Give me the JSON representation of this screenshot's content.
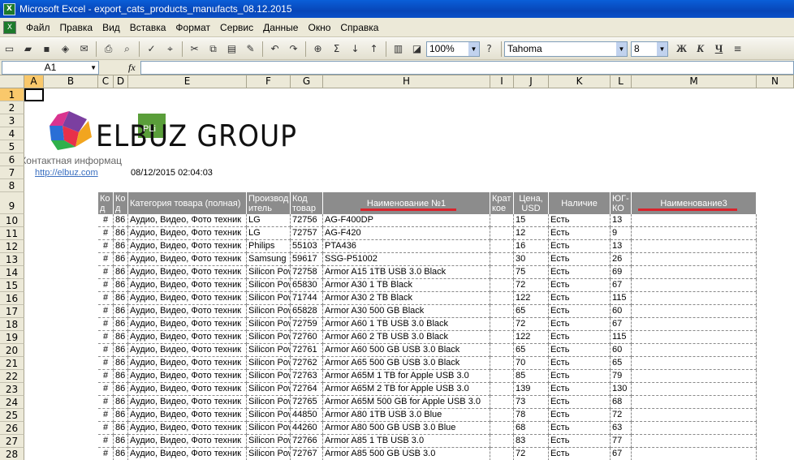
{
  "window": {
    "title": "Microsoft Excel - export_cats_products_manufacts_08.12.2015",
    "app_icon": "excel-icon"
  },
  "menu": [
    "Файл",
    "Правка",
    "Вид",
    "Вставка",
    "Формат",
    "Сервис",
    "Данные",
    "Окно",
    "Справка"
  ],
  "toolbar": {
    "zoom": "100%",
    "font": "Tahoma",
    "size": "8",
    "bold": "Ж",
    "italic": "К",
    "underline": "Ч"
  },
  "formula": {
    "cell": "A1",
    "fx": "fx"
  },
  "columns": [
    "A",
    "B",
    "C",
    "D",
    "E",
    "F",
    "G",
    "H",
    "I",
    "J",
    "K",
    "L",
    "M",
    "N"
  ],
  "rows": [
    "1",
    "2",
    "3",
    "4",
    "5",
    "6",
    "7",
    "8",
    "9",
    "10",
    "11",
    "12",
    "13",
    "14",
    "15",
    "16",
    "17",
    "18",
    "19",
    "20",
    "21",
    "22",
    "23",
    "24",
    "25",
    "26",
    "27",
    "28"
  ],
  "sheet": {
    "logo_text": "ELBUZ GROUP",
    "logo_badge": "PLi",
    "contact": "Контактная информац",
    "link": "http://elbuz.com",
    "datetime": "08/12/2015 02:04:03"
  },
  "headers": [
    "Ко д",
    "Ко д",
    "Категория товара (полная)",
    "Производ итель",
    "Код товар",
    "Наименование №1",
    "Крат кое",
    "Цена, USD",
    "Наличие",
    "ЮГ-КО",
    "Наименование3"
  ],
  "products": [
    {
      "c": "#",
      "d": "86",
      "cat": "Аудио, Видео, Фото техник",
      "mfr": "LG",
      "code": "72756",
      "name": "AG-F400DP",
      "price": "15",
      "stock": "Есть",
      "yug": "13"
    },
    {
      "c": "#",
      "d": "86",
      "cat": "Аудио, Видео, Фото техник",
      "mfr": "LG",
      "code": "72757",
      "name": "AG-F420",
      "price": "12",
      "stock": "Есть",
      "yug": "9"
    },
    {
      "c": "#",
      "d": "86",
      "cat": "Аудио, Видео, Фото техник",
      "mfr": "Philips",
      "code": "55103",
      "name": "PTA436",
      "price": "16",
      "stock": "Есть",
      "yug": "13"
    },
    {
      "c": "#",
      "d": "86",
      "cat": "Аудио, Видео, Фото техник",
      "mfr": "Samsung",
      "code": "59617",
      "name": "SSG-P51002",
      "price": "30",
      "stock": "Есть",
      "yug": "26"
    },
    {
      "c": "#",
      "d": "86",
      "cat": "Аудио, Видео, Фото техник",
      "mfr": "Silicon Pow",
      "code": "72758",
      "name": "Armor A15 1TB USB 3.0 Black",
      "price": "75",
      "stock": "Есть",
      "yug": "69"
    },
    {
      "c": "#",
      "d": "86",
      "cat": "Аудио, Видео, Фото техник",
      "mfr": "Silicon Pow",
      "code": "65830",
      "name": "Armor A30 1 TB Black",
      "price": "72",
      "stock": "Есть",
      "yug": "67"
    },
    {
      "c": "#",
      "d": "86",
      "cat": "Аудио, Видео, Фото техник",
      "mfr": "Silicon Pow",
      "code": "71744",
      "name": "Armor A30 2 TB Black",
      "price": "122",
      "stock": "Есть",
      "yug": "115"
    },
    {
      "c": "#",
      "d": "86",
      "cat": "Аудио, Видео, Фото техник",
      "mfr": "Silicon Pow",
      "code": "65828",
      "name": "Armor A30 500 GB Black",
      "price": "65",
      "stock": "Есть",
      "yug": "60"
    },
    {
      "c": "#",
      "d": "86",
      "cat": "Аудио, Видео, Фото техник",
      "mfr": "Silicon Pow",
      "code": "72759",
      "name": "Armor A60 1 TB USB 3.0 Black",
      "price": "72",
      "stock": "Есть",
      "yug": "67"
    },
    {
      "c": "#",
      "d": "86",
      "cat": "Аудио, Видео, Фото техник",
      "mfr": "Silicon Pow",
      "code": "72760",
      "name": "Armor A60 2 TB USB 3.0 Black",
      "price": "122",
      "stock": "Есть",
      "yug": "115"
    },
    {
      "c": "#",
      "d": "86",
      "cat": "Аудио, Видео, Фото техник",
      "mfr": "Silicon Pow",
      "code": "72761",
      "name": "Armor A60 500 GB USB 3.0 Black",
      "price": "65",
      "stock": "Есть",
      "yug": "60"
    },
    {
      "c": "#",
      "d": "86",
      "cat": "Аудио, Видео, Фото техник",
      "mfr": "Silicon Pow",
      "code": "72762",
      "name": "Armor A65 500 GB USB 3.0 Black",
      "price": "70",
      "stock": "Есть",
      "yug": "65"
    },
    {
      "c": "#",
      "d": "86",
      "cat": "Аудио, Видео, Фото техник",
      "mfr": "Silicon Pow",
      "code": "72763",
      "name": "Armor A65M 1 TB for Apple USB 3.0",
      "price": "85",
      "stock": "Есть",
      "yug": "79"
    },
    {
      "c": "#",
      "d": "86",
      "cat": "Аудио, Видео, Фото техник",
      "mfr": "Silicon Pow",
      "code": "72764",
      "name": "Armor A65M 2 TB for Apple USB 3.0",
      "price": "139",
      "stock": "Есть",
      "yug": "130"
    },
    {
      "c": "#",
      "d": "86",
      "cat": "Аудио, Видео, Фото техник",
      "mfr": "Silicon Pow",
      "code": "72765",
      "name": "Armor A65M 500 GB for Apple USB 3.0",
      "price": "73",
      "stock": "Есть",
      "yug": "68"
    },
    {
      "c": "#",
      "d": "86",
      "cat": "Аудио, Видео, Фото техник",
      "mfr": "Silicon Pow",
      "code": "44850",
      "name": "Armor A80 1TB USB 3.0 Blue",
      "price": "78",
      "stock": "Есть",
      "yug": "72"
    },
    {
      "c": "#",
      "d": "86",
      "cat": "Аудио, Видео, Фото техник",
      "mfr": "Silicon Pow",
      "code": "44260",
      "name": "Armor A80 500 GB USB 3.0 Blue",
      "price": "68",
      "stock": "Есть",
      "yug": "63"
    },
    {
      "c": "#",
      "d": "86",
      "cat": "Аудио, Видео, Фото техник",
      "mfr": "Silicon Pow",
      "code": "72766",
      "name": "Armor A85 1 TB USB 3.0",
      "price": "83",
      "stock": "Есть",
      "yug": "77"
    },
    {
      "c": "#",
      "d": "86",
      "cat": "Аудио, Видео, Фото техник",
      "mfr": "Silicon Pow",
      "code": "72767",
      "name": "Armor A85 500 GB USB 3.0",
      "price": "72",
      "stock": "Есть",
      "yug": "67"
    }
  ],
  "colors": {
    "selection": "#f9c86b",
    "header_bg": "#8c8c8c",
    "underline": "#d9232b",
    "link": "#3a6fc0"
  }
}
